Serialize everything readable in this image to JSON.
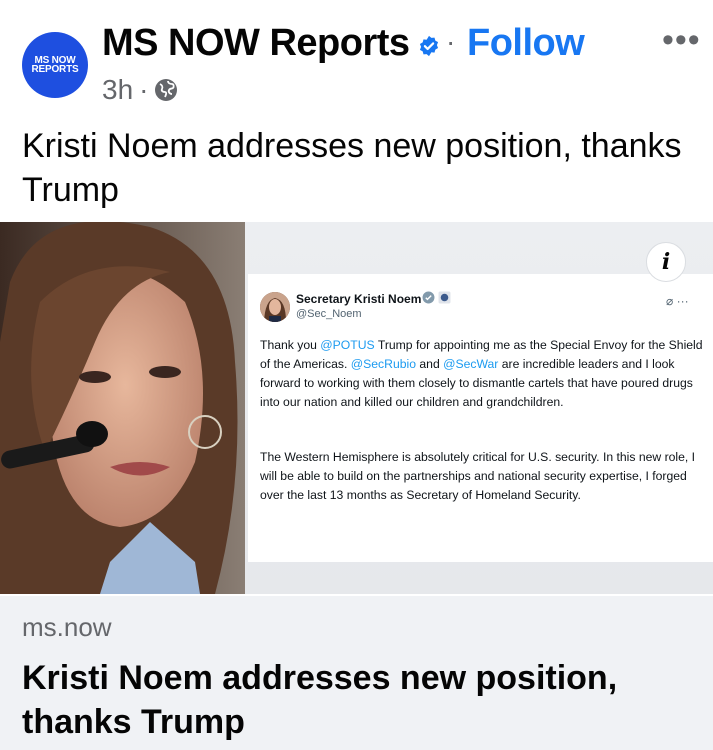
{
  "post": {
    "page_name": "MS NOW Reports",
    "avatar_line1": "MS NOW",
    "avatar_line2": "REPORTS",
    "separator": "·",
    "follow_label": "Follow",
    "more_label": "•••",
    "time": "3h",
    "time_separator": "·",
    "text": "Kristi Noem addresses new position, thanks Trump"
  },
  "tweet": {
    "name": "Secretary Kristi Noem",
    "handle": "@Sec_Noem",
    "p1_a": "Thank you ",
    "p1_m1": "@POTUS",
    "p1_b": " Trump for appointing me as the Special Envoy for the Shield of the Americas. ",
    "p1_m2": "@SecRubio",
    "p1_c": " and ",
    "p1_m3": "@SecWar",
    "p1_d": " are incredible leaders and I look forward to working with them closely to dismantle cartels that have poured drugs into our nation and killed our children and grandchildren.",
    "p2": "The Western Hemisphere is absolutely critical for U.S. security. In this new role, I will be able to build on the partnerships and national security expertise, I forged over the last 13 months as Secretary of Homeland Security.",
    "more_label": "···"
  },
  "link": {
    "domain": "ms.now",
    "title": "Kristi Noem addresses new position, thanks Trump"
  },
  "info_label": "i",
  "colors": {
    "brand_blue": "#1e4fe0",
    "follow_blue": "#1877f2",
    "mention_blue": "#1d9bf0",
    "link_bg": "#f0f2f5"
  }
}
